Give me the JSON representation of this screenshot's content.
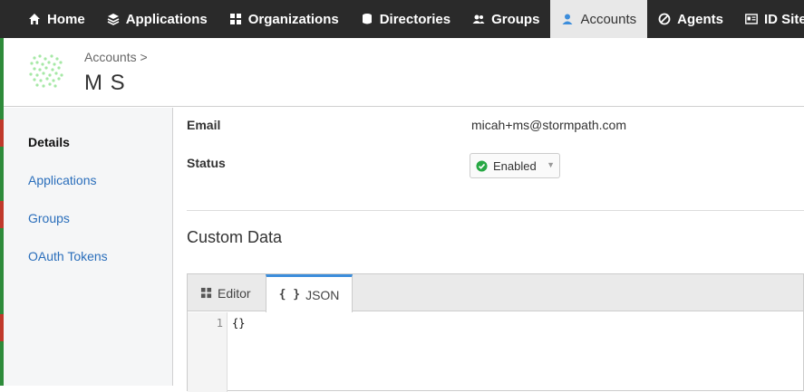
{
  "nav": {
    "items": [
      {
        "label": "Home",
        "icon": "home-icon"
      },
      {
        "label": "Applications",
        "icon": "layers-icon"
      },
      {
        "label": "Organizations",
        "icon": "grid-icon"
      },
      {
        "label": "Directories",
        "icon": "database-icon"
      },
      {
        "label": "Groups",
        "icon": "users-icon"
      },
      {
        "label": "Accounts",
        "icon": "user-icon"
      },
      {
        "label": "Agents",
        "icon": "agent-icon"
      },
      {
        "label": "ID Site",
        "icon": "id-card-icon"
      }
    ],
    "active": "Accounts"
  },
  "header": {
    "breadcrumb": "Accounts >",
    "account_name": "M S"
  },
  "sidebar": {
    "items": [
      {
        "label": "Details"
      },
      {
        "label": "Applications"
      },
      {
        "label": "Groups"
      },
      {
        "label": "OAuth Tokens"
      }
    ],
    "active": "Details"
  },
  "details": {
    "email_label": "Email",
    "email_value": "micah+ms@stormpath.com",
    "status_label": "Status",
    "status_value": "Enabled"
  },
  "custom_data": {
    "title": "Custom Data",
    "tabs": [
      {
        "label": "Editor"
      },
      {
        "label": "JSON"
      }
    ],
    "active_tab": "JSON",
    "line_number": "1",
    "code": "{}"
  },
  "colors": {
    "nav_bg": "#2a2a2a",
    "link": "#2a6ebb",
    "status_green": "#27a844",
    "tab_accent": "#3c8ddb"
  }
}
